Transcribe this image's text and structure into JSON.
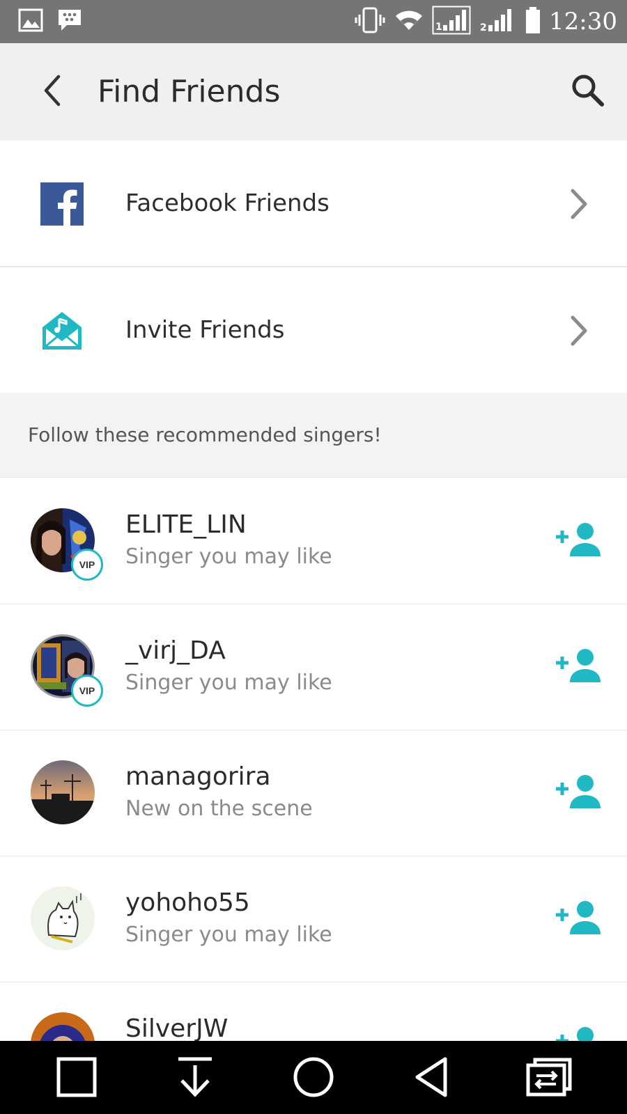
{
  "status_bar": {
    "time": "12:30",
    "icons": [
      "image-icon",
      "bbm-icon",
      "vibrate-icon",
      "wifi-icon",
      "signal-sim1-icon",
      "signal-sim2-icon",
      "battery-icon"
    ]
  },
  "app_bar": {
    "title": "Find Friends",
    "back_icon": "back-arrow-icon",
    "search_icon": "search-icon"
  },
  "options": [
    {
      "label": "Facebook Friends",
      "icon": "facebook-icon"
    },
    {
      "label": "Invite Friends",
      "icon": "invite-envelope-icon"
    }
  ],
  "recommended": {
    "header": "Follow these recommended singers!",
    "singers": [
      {
        "name": "ELITE_LIN",
        "subtitle": "Singer you may like",
        "vip": "VIP"
      },
      {
        "name": "_virj_DA",
        "subtitle": "Singer you may like",
        "vip": "VIP"
      },
      {
        "name": "managorira",
        "subtitle": "New on the scene",
        "vip": ""
      },
      {
        "name": "yohoho55",
        "subtitle": "Singer you may like",
        "vip": ""
      },
      {
        "name": "SilverJW",
        "subtitle": "",
        "vip": ""
      }
    ]
  },
  "colors": {
    "accent": "#1fb8c3",
    "facebook": "#3b5998",
    "status_bar": "#757575",
    "app_bar": "#f0f0f0",
    "nav_bar": "#000000"
  },
  "nav_bar": {
    "icons": [
      "recent-apps-icon",
      "download-icon",
      "home-icon",
      "back-nav-icon",
      "dual-window-icon"
    ]
  }
}
